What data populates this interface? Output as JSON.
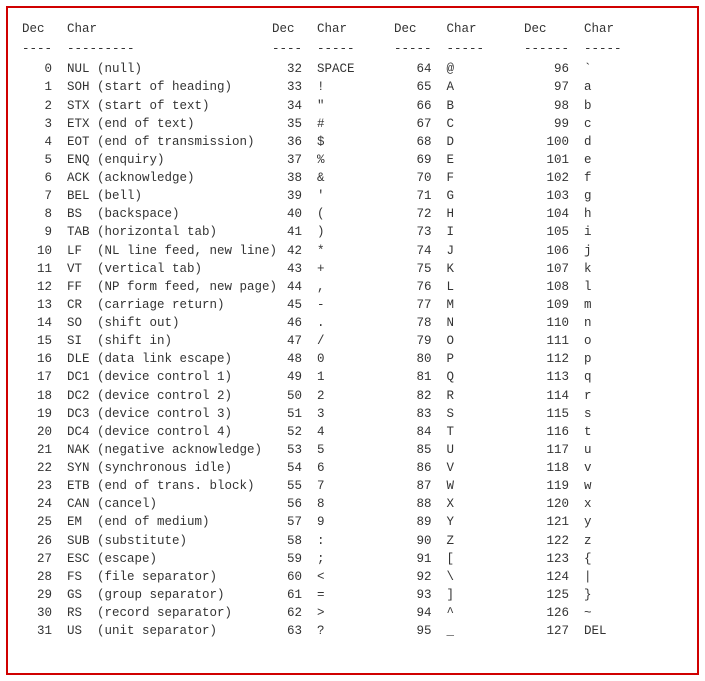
{
  "headers": {
    "dec": "Dec",
    "char": "Char"
  },
  "dash_row": "---------",
  "columns": [
    [
      {
        "dec": 0,
        "abbr": "NUL",
        "desc": "(null)"
      },
      {
        "dec": 1,
        "abbr": "SOH",
        "desc": "(start of heading)"
      },
      {
        "dec": 2,
        "abbr": "STX",
        "desc": "(start of text)"
      },
      {
        "dec": 3,
        "abbr": "ETX",
        "desc": "(end of text)"
      },
      {
        "dec": 4,
        "abbr": "EOT",
        "desc": "(end of transmission)"
      },
      {
        "dec": 5,
        "abbr": "ENQ",
        "desc": "(enquiry)"
      },
      {
        "dec": 6,
        "abbr": "ACK",
        "desc": "(acknowledge)"
      },
      {
        "dec": 7,
        "abbr": "BEL",
        "desc": "(bell)"
      },
      {
        "dec": 8,
        "abbr": "BS",
        "desc": "(backspace)"
      },
      {
        "dec": 9,
        "abbr": "TAB",
        "desc": "(horizontal tab)"
      },
      {
        "dec": 10,
        "abbr": "LF",
        "desc": "(NL line feed, new line)"
      },
      {
        "dec": 11,
        "abbr": "VT",
        "desc": "(vertical tab)"
      },
      {
        "dec": 12,
        "abbr": "FF",
        "desc": "(NP form feed, new page)"
      },
      {
        "dec": 13,
        "abbr": "CR",
        "desc": "(carriage return)"
      },
      {
        "dec": 14,
        "abbr": "SO",
        "desc": "(shift out)"
      },
      {
        "dec": 15,
        "abbr": "SI",
        "desc": "(shift in)"
      },
      {
        "dec": 16,
        "abbr": "DLE",
        "desc": "(data link escape)"
      },
      {
        "dec": 17,
        "abbr": "DC1",
        "desc": "(device control 1)"
      },
      {
        "dec": 18,
        "abbr": "DC2",
        "desc": "(device control 2)"
      },
      {
        "dec": 19,
        "abbr": "DC3",
        "desc": "(device control 3)"
      },
      {
        "dec": 20,
        "abbr": "DC4",
        "desc": "(device control 4)"
      },
      {
        "dec": 21,
        "abbr": "NAK",
        "desc": "(negative acknowledge)"
      },
      {
        "dec": 22,
        "abbr": "SYN",
        "desc": "(synchronous idle)"
      },
      {
        "dec": 23,
        "abbr": "ETB",
        "desc": "(end of trans. block)"
      },
      {
        "dec": 24,
        "abbr": "CAN",
        "desc": "(cancel)"
      },
      {
        "dec": 25,
        "abbr": "EM",
        "desc": "(end of medium)"
      },
      {
        "dec": 26,
        "abbr": "SUB",
        "desc": "(substitute)"
      },
      {
        "dec": 27,
        "abbr": "ESC",
        "desc": "(escape)"
      },
      {
        "dec": 28,
        "abbr": "FS",
        "desc": "(file separator)"
      },
      {
        "dec": 29,
        "abbr": "GS",
        "desc": "(group separator)"
      },
      {
        "dec": 30,
        "abbr": "RS",
        "desc": "(record separator)"
      },
      {
        "dec": 31,
        "abbr": "US",
        "desc": "(unit separator)"
      }
    ],
    [
      {
        "dec": 32,
        "char": "SPACE"
      },
      {
        "dec": 33,
        "char": "!"
      },
      {
        "dec": 34,
        "char": "\""
      },
      {
        "dec": 35,
        "char": "#"
      },
      {
        "dec": 36,
        "char": "$"
      },
      {
        "dec": 37,
        "char": "%"
      },
      {
        "dec": 38,
        "char": "&"
      },
      {
        "dec": 39,
        "char": "'"
      },
      {
        "dec": 40,
        "char": "("
      },
      {
        "dec": 41,
        "char": ")"
      },
      {
        "dec": 42,
        "char": "*"
      },
      {
        "dec": 43,
        "char": "+"
      },
      {
        "dec": 44,
        "char": ","
      },
      {
        "dec": 45,
        "char": "-"
      },
      {
        "dec": 46,
        "char": "."
      },
      {
        "dec": 47,
        "char": "/"
      },
      {
        "dec": 48,
        "char": "0"
      },
      {
        "dec": 49,
        "char": "1"
      },
      {
        "dec": 50,
        "char": "2"
      },
      {
        "dec": 51,
        "char": "3"
      },
      {
        "dec": 52,
        "char": "4"
      },
      {
        "dec": 53,
        "char": "5"
      },
      {
        "dec": 54,
        "char": "6"
      },
      {
        "dec": 55,
        "char": "7"
      },
      {
        "dec": 56,
        "char": "8"
      },
      {
        "dec": 57,
        "char": "9"
      },
      {
        "dec": 58,
        "char": ":"
      },
      {
        "dec": 59,
        "char": ";"
      },
      {
        "dec": 60,
        "char": "<"
      },
      {
        "dec": 61,
        "char": "="
      },
      {
        "dec": 62,
        "char": ">"
      },
      {
        "dec": 63,
        "char": "?"
      }
    ],
    [
      {
        "dec": 64,
        "char": "@"
      },
      {
        "dec": 65,
        "char": "A"
      },
      {
        "dec": 66,
        "char": "B"
      },
      {
        "dec": 67,
        "char": "C"
      },
      {
        "dec": 68,
        "char": "D"
      },
      {
        "dec": 69,
        "char": "E"
      },
      {
        "dec": 70,
        "char": "F"
      },
      {
        "dec": 71,
        "char": "G"
      },
      {
        "dec": 72,
        "char": "H"
      },
      {
        "dec": 73,
        "char": "I"
      },
      {
        "dec": 74,
        "char": "J"
      },
      {
        "dec": 75,
        "char": "K"
      },
      {
        "dec": 76,
        "char": "L"
      },
      {
        "dec": 77,
        "char": "M"
      },
      {
        "dec": 78,
        "char": "N"
      },
      {
        "dec": 79,
        "char": "O"
      },
      {
        "dec": 80,
        "char": "P"
      },
      {
        "dec": 81,
        "char": "Q"
      },
      {
        "dec": 82,
        "char": "R"
      },
      {
        "dec": 83,
        "char": "S"
      },
      {
        "dec": 84,
        "char": "T"
      },
      {
        "dec": 85,
        "char": "U"
      },
      {
        "dec": 86,
        "char": "V"
      },
      {
        "dec": 87,
        "char": "W"
      },
      {
        "dec": 88,
        "char": "X"
      },
      {
        "dec": 89,
        "char": "Y"
      },
      {
        "dec": 90,
        "char": "Z"
      },
      {
        "dec": 91,
        "char": "["
      },
      {
        "dec": 92,
        "char": "\\"
      },
      {
        "dec": 93,
        "char": "]"
      },
      {
        "dec": 94,
        "char": "^"
      },
      {
        "dec": 95,
        "char": "_"
      }
    ],
    [
      {
        "dec": 96,
        "char": "`"
      },
      {
        "dec": 97,
        "char": "a"
      },
      {
        "dec": 98,
        "char": "b"
      },
      {
        "dec": 99,
        "char": "c"
      },
      {
        "dec": 100,
        "char": "d"
      },
      {
        "dec": 101,
        "char": "e"
      },
      {
        "dec": 102,
        "char": "f"
      },
      {
        "dec": 103,
        "char": "g"
      },
      {
        "dec": 104,
        "char": "h"
      },
      {
        "dec": 105,
        "char": "i"
      },
      {
        "dec": 106,
        "char": "j"
      },
      {
        "dec": 107,
        "char": "k"
      },
      {
        "dec": 108,
        "char": "l"
      },
      {
        "dec": 109,
        "char": "m"
      },
      {
        "dec": 110,
        "char": "n"
      },
      {
        "dec": 111,
        "char": "o"
      },
      {
        "dec": 112,
        "char": "p"
      },
      {
        "dec": 113,
        "char": "q"
      },
      {
        "dec": 114,
        "char": "r"
      },
      {
        "dec": 115,
        "char": "s"
      },
      {
        "dec": 116,
        "char": "t"
      },
      {
        "dec": 117,
        "char": "u"
      },
      {
        "dec": 118,
        "char": "v"
      },
      {
        "dec": 119,
        "char": "w"
      },
      {
        "dec": 120,
        "char": "x"
      },
      {
        "dec": 121,
        "char": "y"
      },
      {
        "dec": 122,
        "char": "z"
      },
      {
        "dec": 123,
        "char": "{"
      },
      {
        "dec": 124,
        "char": "|"
      },
      {
        "dec": 125,
        "char": "}"
      },
      {
        "dec": 126,
        "char": "~"
      },
      {
        "dec": 127,
        "char": "DEL"
      }
    ]
  ]
}
